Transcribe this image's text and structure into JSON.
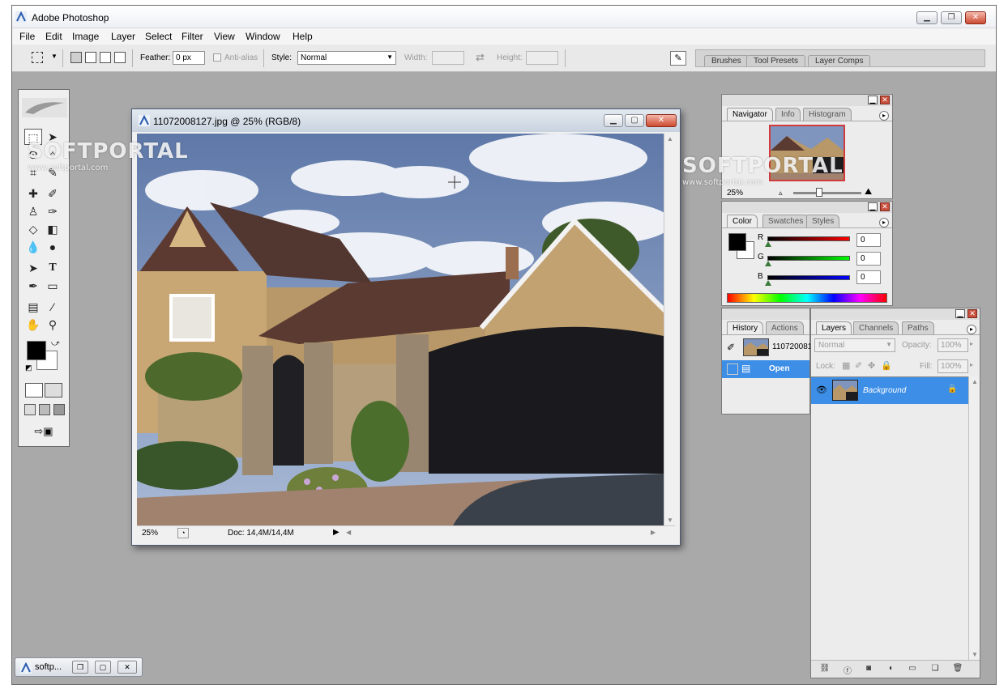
{
  "app": {
    "title": "Adobe Photoshop",
    "menu": [
      "File",
      "Edit",
      "Image",
      "Layer",
      "Select",
      "Filter",
      "View",
      "Window",
      "Help"
    ]
  },
  "options": {
    "feather_label": "Feather:",
    "feather_value": "0 px",
    "antialias_label": "Anti-alias",
    "style_label": "Style:",
    "style_value": "Normal",
    "width_label": "Width:",
    "height_label": "Height:",
    "well_tabs": [
      "Brushes",
      "Tool Presets",
      "Layer Comps"
    ]
  },
  "document": {
    "title": "11072008127.jpg @ 25% (RGB/8)",
    "zoom": "25%",
    "doc_size": "Doc: 14,4M/14,4M"
  },
  "navigator": {
    "tabs": [
      "Navigator",
      "Info",
      "Histogram"
    ],
    "zoom": "25%"
  },
  "color": {
    "tabs": [
      "Color",
      "Swatches",
      "Styles"
    ],
    "channels": [
      {
        "label": "R",
        "value": "0",
        "color": "#cc0000"
      },
      {
        "label": "G",
        "value": "0",
        "color": "#00aa00"
      },
      {
        "label": "B",
        "value": "0",
        "color": "#0000cc"
      }
    ]
  },
  "history": {
    "tabs": [
      "History",
      "Actions"
    ],
    "snapshot": "110720081",
    "state": "Open"
  },
  "layers": {
    "tabs": [
      "Layers",
      "Channels",
      "Paths"
    ],
    "blend_mode": "Normal",
    "opacity_label": "Opacity:",
    "opacity": "100%",
    "lock_label": "Lock:",
    "fill_label": "Fill:",
    "fill": "100%",
    "layer_name": "Background"
  },
  "taskbar": {
    "label": "softp..."
  },
  "watermark": {
    "text": "SOFTPORTAL",
    "url": "www.softportal.com"
  }
}
